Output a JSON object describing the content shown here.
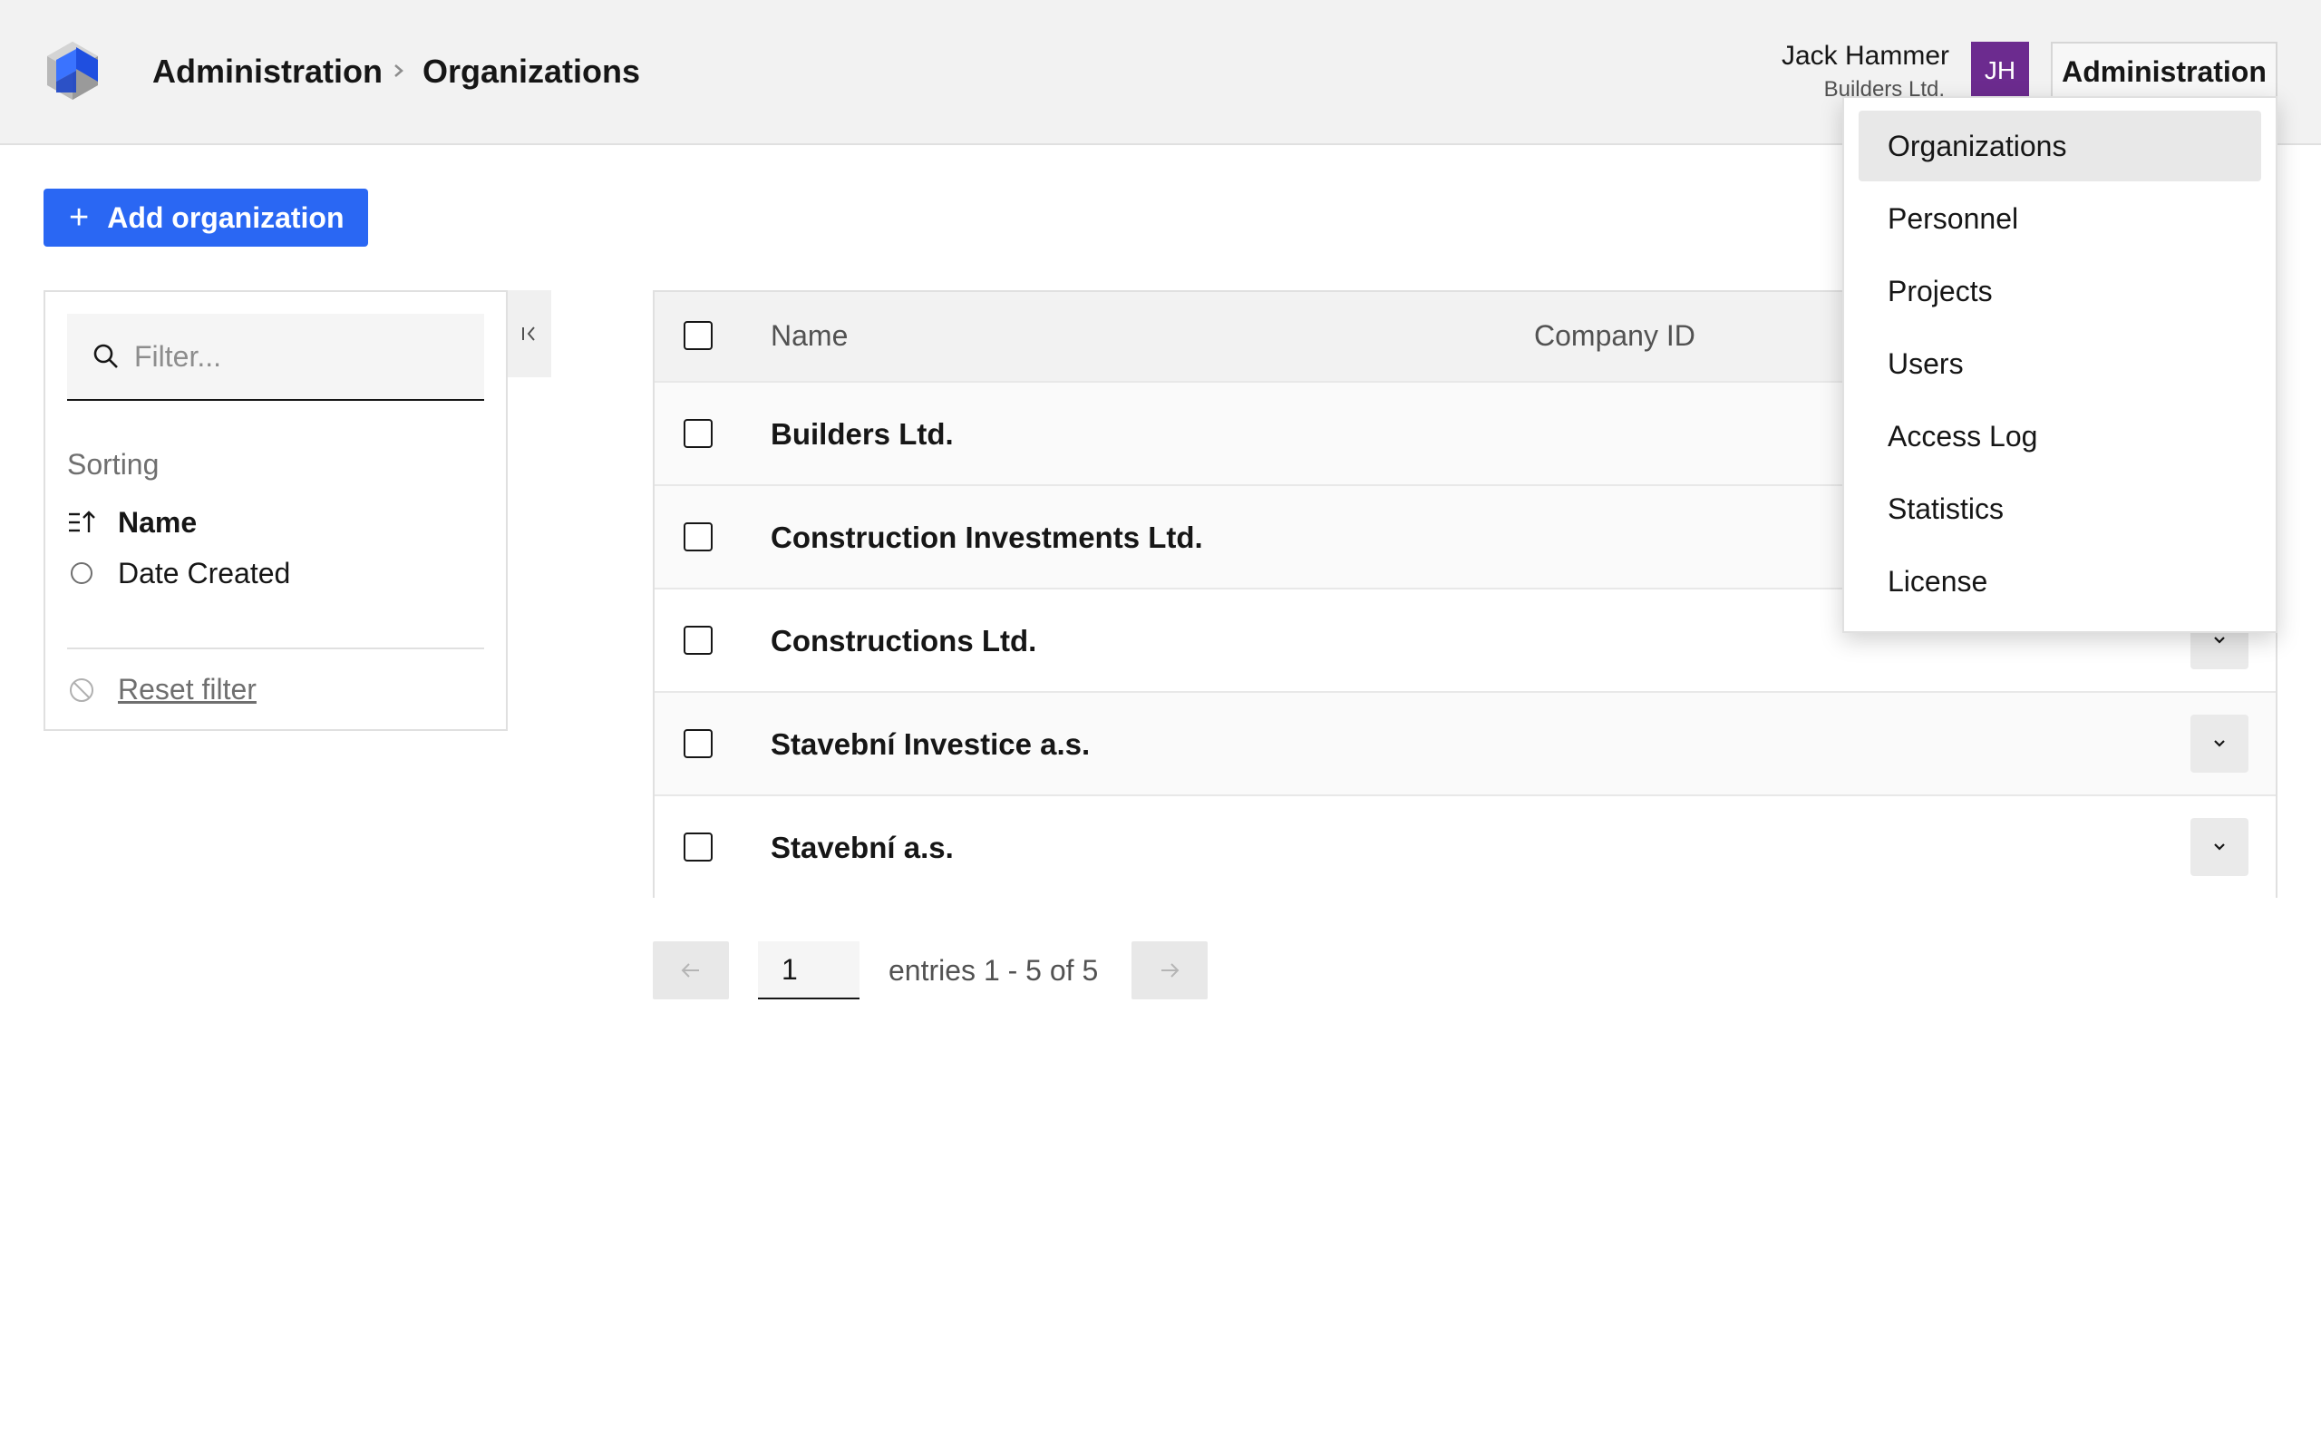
{
  "header": {
    "breadcrumb": [
      "Administration",
      "Organizations"
    ],
    "user": {
      "name": "Jack Hammer",
      "org": "Builders Ltd.",
      "initials": "JH"
    },
    "admin_button": "Administration",
    "avatar_color": "#6c2b8f"
  },
  "toolbar": {
    "add_label": "Add organization",
    "accent": "#2a67f3"
  },
  "filter": {
    "search_placeholder": "Filter...",
    "sorting_label": "Sorting",
    "sort_options": [
      {
        "label": "Name",
        "selected": true,
        "icon": "sort-ascending-icon"
      },
      {
        "label": "Date Created",
        "selected": false,
        "icon": "radio-empty-icon"
      }
    ],
    "reset_label": "Reset filter"
  },
  "table": {
    "columns": [
      "Name",
      "Company ID"
    ],
    "rows": [
      {
        "name": "Builders Ltd."
      },
      {
        "name": "Construction Investments Ltd."
      },
      {
        "name": "Constructions Ltd."
      },
      {
        "name": "Stavební Investice a.s."
      },
      {
        "name": "Stavební a.s."
      }
    ]
  },
  "pagination": {
    "page": "1",
    "summary": "entries 1 - 5 of 5"
  },
  "menu": {
    "items": [
      {
        "label": "Organizations",
        "active": true
      },
      {
        "label": "Personnel",
        "active": false
      },
      {
        "label": "Projects",
        "active": false
      },
      {
        "label": "Users",
        "active": false
      },
      {
        "label": "Access Log",
        "active": false
      },
      {
        "label": "Statistics",
        "active": false
      },
      {
        "label": "License",
        "active": false
      }
    ]
  }
}
